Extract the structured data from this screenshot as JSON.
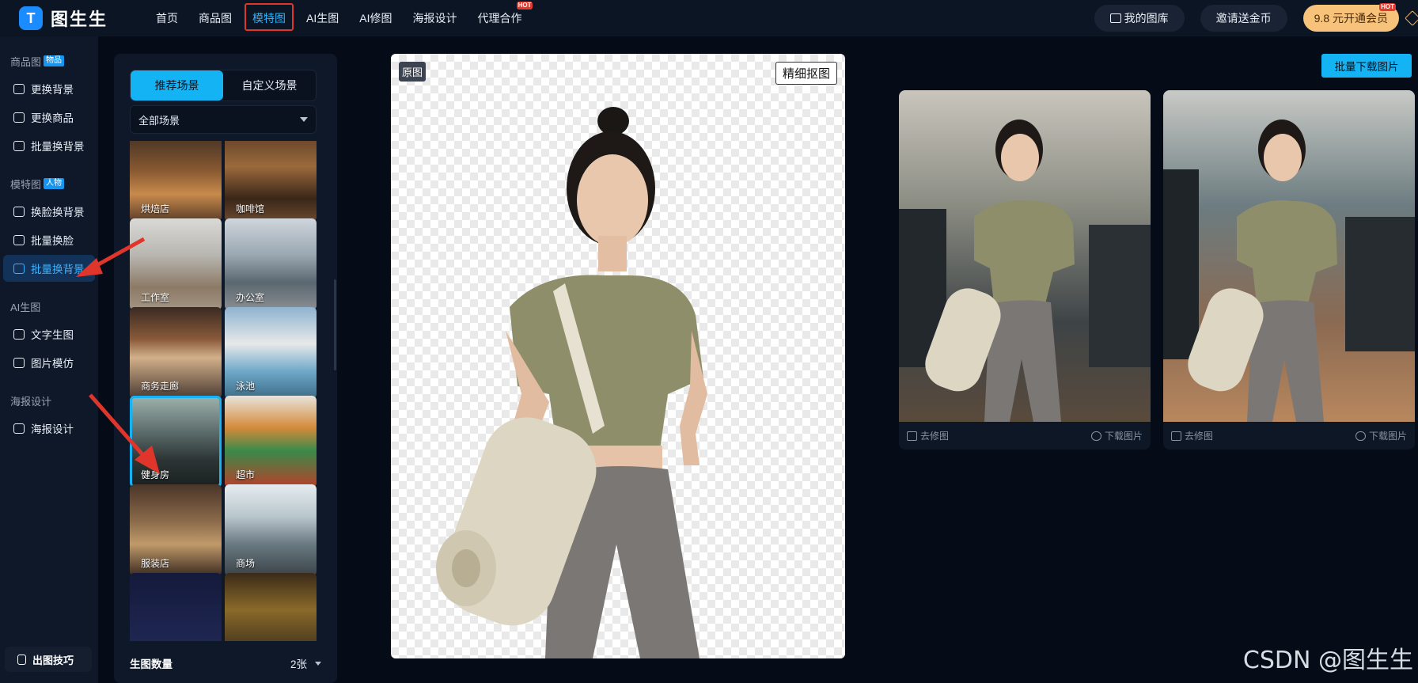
{
  "brand": {
    "name": "图生生"
  },
  "nav": [
    {
      "label": "首页",
      "active": false,
      "hot": false
    },
    {
      "label": "商品图",
      "active": false,
      "hot": false
    },
    {
      "label": "模特图",
      "active": true,
      "hot": false
    },
    {
      "label": "AI生图",
      "active": false,
      "hot": false
    },
    {
      "label": "AI修图",
      "active": false,
      "hot": false
    },
    {
      "label": "海报设计",
      "active": false,
      "hot": false
    },
    {
      "label": "代理合作",
      "active": false,
      "hot": true
    }
  ],
  "top_right": {
    "library": "我的图库",
    "invite": "邀请送金币",
    "vip": "9.8 元开通会员",
    "hot_badge": "HOT"
  },
  "sidebar": {
    "sections": [
      {
        "title": "商品图",
        "badge": "物品",
        "items": [
          "更换背景",
          "更换商品",
          "批量换背景"
        ]
      },
      {
        "title": "模特图",
        "badge": "人物",
        "items": [
          "换脸换背景",
          "批量换脸",
          "批量换背景"
        ]
      },
      {
        "title": "AI生图",
        "badge": "",
        "items": [
          "文字生图",
          "图片模仿"
        ]
      },
      {
        "title": "海报设计",
        "badge": "",
        "items": [
          "海报设计"
        ]
      }
    ],
    "active_item": "模特图/批量换背景",
    "tips": "出图技巧"
  },
  "scene_panel": {
    "tabs": [
      "推荐场景",
      "自定义场景"
    ],
    "active_tab": 0,
    "filter": "全部场景",
    "scenes": [
      "烘焙店",
      "咖啡馆",
      "工作室",
      "办公室",
      "商务走廊",
      "泳池",
      "健身房",
      "超市",
      "服装店",
      "商场",
      "",
      ""
    ],
    "selected_scene": "健身房",
    "count_label": "生图数量",
    "count_value": "2张"
  },
  "original": {
    "tag": "原图",
    "refine_button": "精细抠图"
  },
  "batch_download": "批量下载图片",
  "results": [
    {
      "edit": "去修图",
      "download": "下载图片"
    },
    {
      "edit": "去修图",
      "download": "下载图片"
    }
  ],
  "watermark": "CSDN @图生生"
}
